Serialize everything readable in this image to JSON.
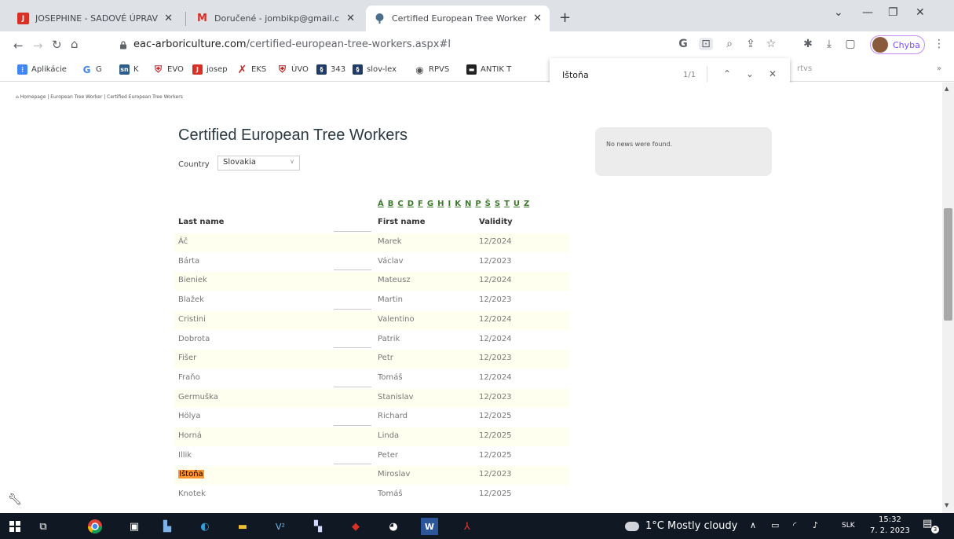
{
  "tabs": [
    {
      "title": "JOSEPHINE - SADOVÉ ÚPRAVY \\",
      "icon": "J",
      "color": "#d93025"
    },
    {
      "title": "Doručené - jombikp@gmail.com",
      "icon": "M",
      "color": "#d93025"
    },
    {
      "title": "Certified European Tree Workers",
      "icon": "tree-icon",
      "color": "#4a6f8c"
    }
  ],
  "address": {
    "domain": "eac-arboriculture.com",
    "path": "/certified-european-tree-workers.aspx#l"
  },
  "profile": {
    "label": "Chyba"
  },
  "bookmarks": [
    {
      "label": "Aplikácie",
      "color": "#4285f4"
    },
    {
      "label": "G",
      "color": "#4285f4"
    },
    {
      "label": "K",
      "color": "#2c5c8a"
    },
    {
      "label": "EVO",
      "color": "#c62828"
    },
    {
      "label": "josep",
      "color": "#d93025"
    },
    {
      "label": "EKS",
      "color": "#c62828"
    },
    {
      "label": "ÚVO",
      "color": "#b71c1c"
    },
    {
      "label": "343",
      "color": "#1f3b66"
    },
    {
      "label": "slov-lex",
      "color": "#1f3b66"
    },
    {
      "label": "RPVS",
      "color": "#555555"
    },
    {
      "label": "ANTIK T",
      "color": "#222222"
    },
    {
      "label": "rtvs",
      "color": "#555555"
    }
  ],
  "find": {
    "query": "Ištoňa",
    "count": "1/1"
  },
  "breadcrumb": "Homepage | European Tree Worker | Certified European Tree Workers",
  "heading": "Certified European Tree Workers",
  "country": {
    "label": "Country",
    "value": "Slovakia"
  },
  "alphabet": [
    "Á",
    "B",
    "C",
    "D",
    "F",
    "G",
    "H",
    "I",
    "K",
    "N",
    "P",
    "Š",
    "S",
    "T",
    "U",
    "Z"
  ],
  "table": {
    "headers": [
      "Last name",
      "First name",
      "Validity"
    ],
    "rows": [
      [
        "Áč",
        "Marek",
        "12/2024"
      ],
      [
        "Bárta",
        "Václav",
        "12/2023"
      ],
      [
        "Bieniek",
        "Mateusz",
        "12/2024"
      ],
      [
        "Blažek",
        "Martin",
        "12/2023"
      ],
      [
        "Cristini",
        "Valentino",
        "12/2024"
      ],
      [
        "Dobrota",
        "Patrik",
        "12/2024"
      ],
      [
        "Fišer",
        "Petr",
        "12/2023"
      ],
      [
        "Fraňo",
        "Tomáš",
        "12/2024"
      ],
      [
        "Germuška",
        "Stanislav",
        "12/2023"
      ],
      [
        "Hölya",
        "Richard",
        "12/2025"
      ],
      [
        "Horná",
        "Linda",
        "12/2025"
      ],
      [
        "Illik",
        "Peter",
        "12/2025"
      ],
      [
        "Ištoňa",
        "Miroslav",
        "12/2023"
      ],
      [
        "Knotek",
        "Tomáš",
        "12/2025"
      ]
    ]
  },
  "news": "No news were found.",
  "taskbar": {
    "weather": "1°C  Mostly cloudy",
    "lang": "SLK",
    "time": "15:32",
    "date": "7. 2. 2023",
    "notifications": "3"
  }
}
